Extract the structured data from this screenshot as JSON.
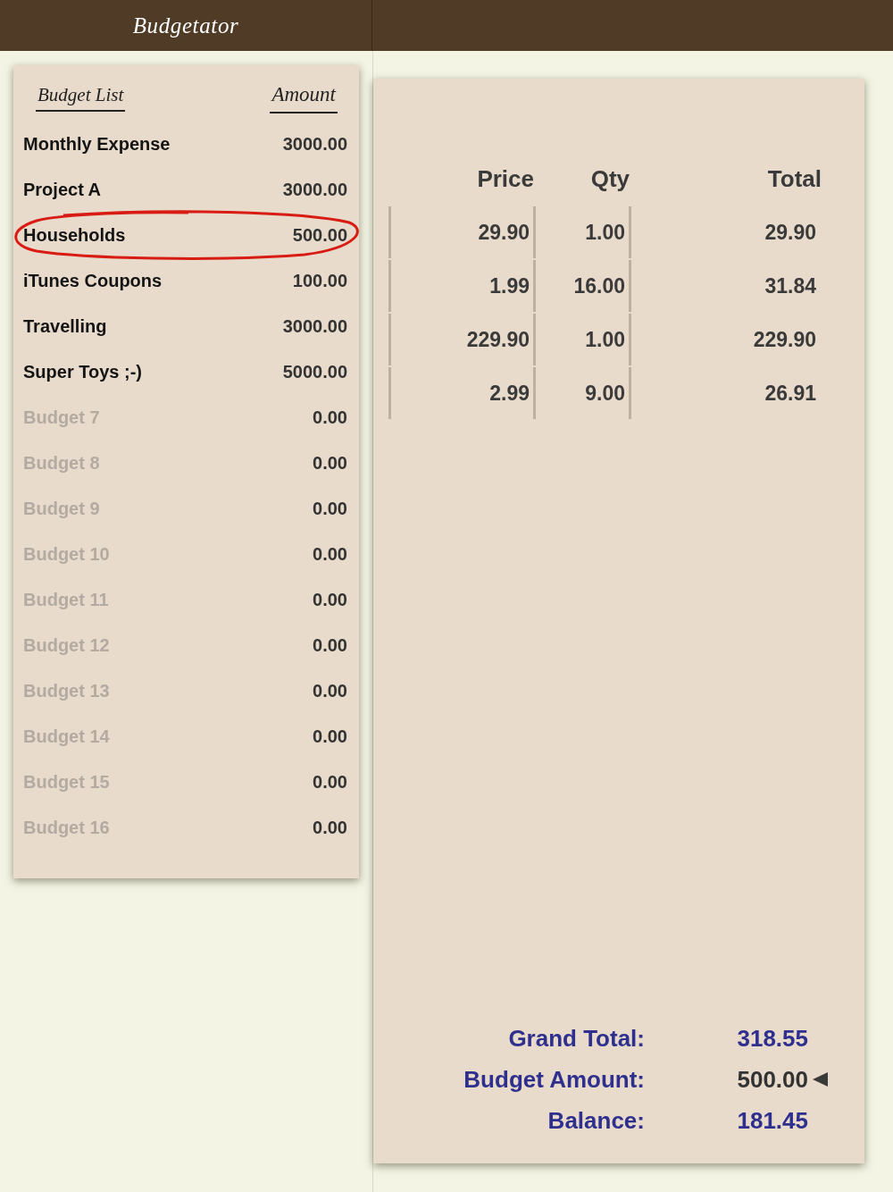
{
  "app": {
    "title": "Budgetator"
  },
  "budget_list": {
    "headers": {
      "name": "Budget List",
      "amount": "Amount"
    },
    "items": [
      {
        "name": "Monthly Expense",
        "amount": "3000.00",
        "in_use": true,
        "selected": false
      },
      {
        "name": "Project A",
        "amount": "3000.00",
        "in_use": true,
        "selected": false
      },
      {
        "name": "Households",
        "amount": "500.00",
        "in_use": true,
        "selected": true
      },
      {
        "name": "iTunes Coupons",
        "amount": "100.00",
        "in_use": true,
        "selected": false
      },
      {
        "name": "Travelling",
        "amount": "3000.00",
        "in_use": true,
        "selected": false
      },
      {
        "name": "Super Toys ;-)",
        "amount": "5000.00",
        "in_use": true,
        "selected": false
      },
      {
        "name": "Budget 7",
        "amount": "0.00",
        "in_use": false,
        "selected": false
      },
      {
        "name": "Budget 8",
        "amount": "0.00",
        "in_use": false,
        "selected": false
      },
      {
        "name": "Budget 9",
        "amount": "0.00",
        "in_use": false,
        "selected": false
      },
      {
        "name": "Budget 10",
        "amount": "0.00",
        "in_use": false,
        "selected": false
      },
      {
        "name": "Budget 11",
        "amount": "0.00",
        "in_use": false,
        "selected": false
      },
      {
        "name": "Budget 12",
        "amount": "0.00",
        "in_use": false,
        "selected": false
      },
      {
        "name": "Budget 13",
        "amount": "0.00",
        "in_use": false,
        "selected": false
      },
      {
        "name": "Budget 14",
        "amount": "0.00",
        "in_use": false,
        "selected": false
      },
      {
        "name": "Budget 15",
        "amount": "0.00",
        "in_use": false,
        "selected": false
      },
      {
        "name": "Budget 16",
        "amount": "0.00",
        "in_use": false,
        "selected": false
      }
    ]
  },
  "detail": {
    "table": {
      "columns": [
        "Price",
        "Qty",
        "Total"
      ],
      "rows": [
        {
          "price": "29.90",
          "qty": "1.00",
          "total": "29.90"
        },
        {
          "price": "1.99",
          "qty": "16.00",
          "total": "31.84"
        },
        {
          "price": "229.90",
          "qty": "1.00",
          "total": "229.90"
        },
        {
          "price": "2.99",
          "qty": "9.00",
          "total": "26.91"
        }
      ]
    },
    "summary": [
      {
        "label": "Grand Total:",
        "value": "318.55",
        "editable": false
      },
      {
        "label": "Budget Amount:",
        "value": "500.00",
        "editable": true
      },
      {
        "label": "Balance:",
        "value": "181.45",
        "editable": false
      }
    ]
  }
}
